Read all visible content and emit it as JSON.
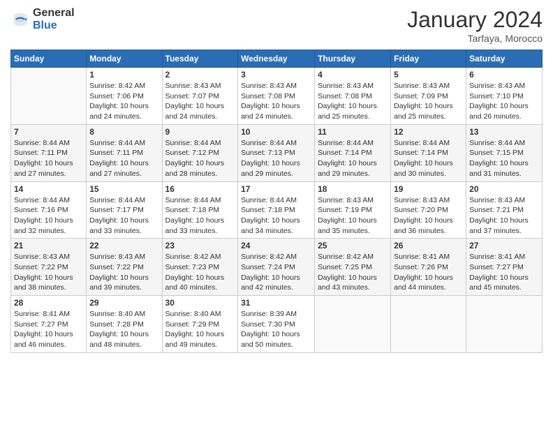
{
  "header": {
    "logo_general": "General",
    "logo_blue": "Blue",
    "title": "January 2024",
    "subtitle": "Tarfaya, Morocco"
  },
  "days_of_week": [
    "Sunday",
    "Monday",
    "Tuesday",
    "Wednesday",
    "Thursday",
    "Friday",
    "Saturday"
  ],
  "weeks": [
    [
      {
        "day": "",
        "info": ""
      },
      {
        "day": "1",
        "info": "Sunrise: 8:42 AM\nSunset: 7:06 PM\nDaylight: 10 hours\nand 24 minutes."
      },
      {
        "day": "2",
        "info": "Sunrise: 8:43 AM\nSunset: 7:07 PM\nDaylight: 10 hours\nand 24 minutes."
      },
      {
        "day": "3",
        "info": "Sunrise: 8:43 AM\nSunset: 7:08 PM\nDaylight: 10 hours\nand 24 minutes."
      },
      {
        "day": "4",
        "info": "Sunrise: 8:43 AM\nSunset: 7:08 PM\nDaylight: 10 hours\nand 25 minutes."
      },
      {
        "day": "5",
        "info": "Sunrise: 8:43 AM\nSunset: 7:09 PM\nDaylight: 10 hours\nand 25 minutes."
      },
      {
        "day": "6",
        "info": "Sunrise: 8:43 AM\nSunset: 7:10 PM\nDaylight: 10 hours\nand 26 minutes."
      }
    ],
    [
      {
        "day": "7",
        "info": "Sunrise: 8:44 AM\nSunset: 7:11 PM\nDaylight: 10 hours\nand 27 minutes."
      },
      {
        "day": "8",
        "info": "Sunrise: 8:44 AM\nSunset: 7:11 PM\nDaylight: 10 hours\nand 27 minutes."
      },
      {
        "day": "9",
        "info": "Sunrise: 8:44 AM\nSunset: 7:12 PM\nDaylight: 10 hours\nand 28 minutes."
      },
      {
        "day": "10",
        "info": "Sunrise: 8:44 AM\nSunset: 7:13 PM\nDaylight: 10 hours\nand 29 minutes."
      },
      {
        "day": "11",
        "info": "Sunrise: 8:44 AM\nSunset: 7:14 PM\nDaylight: 10 hours\nand 29 minutes."
      },
      {
        "day": "12",
        "info": "Sunrise: 8:44 AM\nSunset: 7:14 PM\nDaylight: 10 hours\nand 30 minutes."
      },
      {
        "day": "13",
        "info": "Sunrise: 8:44 AM\nSunset: 7:15 PM\nDaylight: 10 hours\nand 31 minutes."
      }
    ],
    [
      {
        "day": "14",
        "info": "Sunrise: 8:44 AM\nSunset: 7:16 PM\nDaylight: 10 hours\nand 32 minutes."
      },
      {
        "day": "15",
        "info": "Sunrise: 8:44 AM\nSunset: 7:17 PM\nDaylight: 10 hours\nand 33 minutes."
      },
      {
        "day": "16",
        "info": "Sunrise: 8:44 AM\nSunset: 7:18 PM\nDaylight: 10 hours\nand 33 minutes."
      },
      {
        "day": "17",
        "info": "Sunrise: 8:44 AM\nSunset: 7:18 PM\nDaylight: 10 hours\nand 34 minutes."
      },
      {
        "day": "18",
        "info": "Sunrise: 8:43 AM\nSunset: 7:19 PM\nDaylight: 10 hours\nand 35 minutes."
      },
      {
        "day": "19",
        "info": "Sunrise: 8:43 AM\nSunset: 7:20 PM\nDaylight: 10 hours\nand 36 minutes."
      },
      {
        "day": "20",
        "info": "Sunrise: 8:43 AM\nSunset: 7:21 PM\nDaylight: 10 hours\nand 37 minutes."
      }
    ],
    [
      {
        "day": "21",
        "info": "Sunrise: 8:43 AM\nSunset: 7:22 PM\nDaylight: 10 hours\nand 38 minutes."
      },
      {
        "day": "22",
        "info": "Sunrise: 8:43 AM\nSunset: 7:22 PM\nDaylight: 10 hours\nand 39 minutes."
      },
      {
        "day": "23",
        "info": "Sunrise: 8:42 AM\nSunset: 7:23 PM\nDaylight: 10 hours\nand 40 minutes."
      },
      {
        "day": "24",
        "info": "Sunrise: 8:42 AM\nSunset: 7:24 PM\nDaylight: 10 hours\nand 42 minutes."
      },
      {
        "day": "25",
        "info": "Sunrise: 8:42 AM\nSunset: 7:25 PM\nDaylight: 10 hours\nand 43 minutes."
      },
      {
        "day": "26",
        "info": "Sunrise: 8:41 AM\nSunset: 7:26 PM\nDaylight: 10 hours\nand 44 minutes."
      },
      {
        "day": "27",
        "info": "Sunrise: 8:41 AM\nSunset: 7:27 PM\nDaylight: 10 hours\nand 45 minutes."
      }
    ],
    [
      {
        "day": "28",
        "info": "Sunrise: 8:41 AM\nSunset: 7:27 PM\nDaylight: 10 hours\nand 46 minutes."
      },
      {
        "day": "29",
        "info": "Sunrise: 8:40 AM\nSunset: 7:28 PM\nDaylight: 10 hours\nand 48 minutes."
      },
      {
        "day": "30",
        "info": "Sunrise: 8:40 AM\nSunset: 7:29 PM\nDaylight: 10 hours\nand 49 minutes."
      },
      {
        "day": "31",
        "info": "Sunrise: 8:39 AM\nSunset: 7:30 PM\nDaylight: 10 hours\nand 50 minutes."
      },
      {
        "day": "",
        "info": ""
      },
      {
        "day": "",
        "info": ""
      },
      {
        "day": "",
        "info": ""
      }
    ]
  ]
}
